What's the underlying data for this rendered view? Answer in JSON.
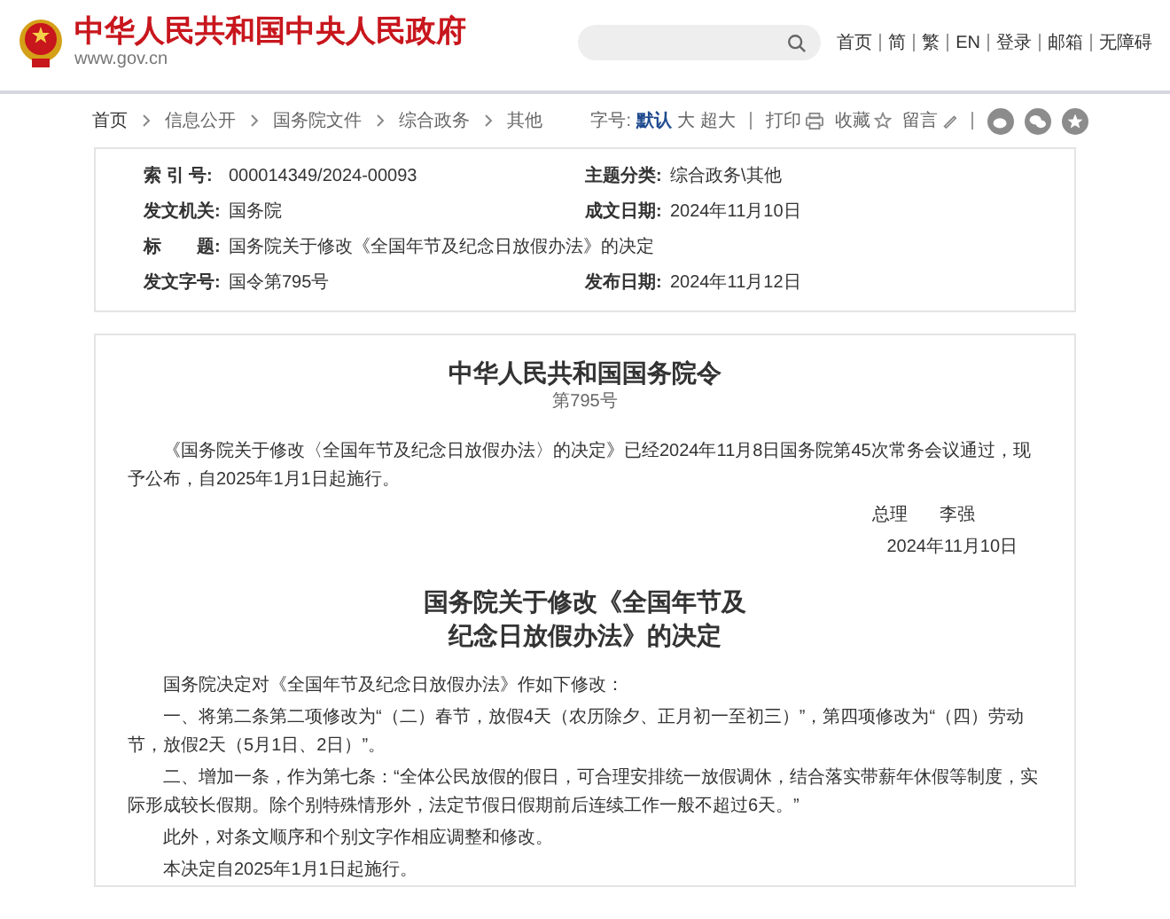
{
  "header": {
    "site_title": "中华人民共和国中央人民政府",
    "domain": "www.gov.cn",
    "nav": [
      {
        "label": "首页"
      },
      {
        "label": "简"
      },
      {
        "label": "繁"
      },
      {
        "label": "EN"
      },
      {
        "label": "登录"
      },
      {
        "label": "邮箱"
      },
      {
        "label": "无障碍"
      }
    ]
  },
  "breadcrumb": [
    {
      "label": "首页"
    },
    {
      "label": "信息公开"
    },
    {
      "label": "国务院文件"
    },
    {
      "label": "综合政务"
    },
    {
      "label": "其他"
    }
  ],
  "tools": {
    "font_label": "字号:",
    "font_sizes": [
      {
        "label": "默认",
        "selected": true
      },
      {
        "label": "大",
        "selected": false
      },
      {
        "label": "超大",
        "selected": false
      }
    ],
    "print": "打印",
    "favorite": "收藏",
    "comment": "留言"
  },
  "meta": [
    [
      {
        "label": "索 引 号:",
        "value": "000014349/2024-00093"
      },
      {
        "label": "主题分类:",
        "value": "综合政务\\其他"
      }
    ],
    [
      {
        "label": "发文机关:",
        "value": "国务院"
      },
      {
        "label": "成文日期:",
        "value": "2024年11月10日"
      }
    ],
    [
      {
        "label": "标　　题:",
        "value": "国务院关于修改《全国年节及纪念日放假办法》的决定"
      }
    ],
    [
      {
        "label": "发文字号:",
        "value": "国令第795号"
      },
      {
        "label": "发布日期:",
        "value": "2024年11月12日"
      }
    ]
  ],
  "document": {
    "title": "中华人民共和国国务院令",
    "number": "第795号",
    "intro": "《国务院关于修改〈全国年节及纪念日放假办法〉的决定》已经2024年11月8日国务院第45次常务会议通过，现予公布，自2025年1月1日起施行。",
    "signer_title": "总理",
    "signer_name": "李强",
    "sign_date": "2024年11月10日",
    "decision_title": [
      "国务院关于修改《全国年节及",
      "纪念日放假办法》的决定"
    ],
    "paragraphs": [
      "国务院决定对《全国年节及纪念日放假办法》作如下修改：",
      "一、将第二条第二项修改为“（二）春节，放假4天（农历除夕、正月初一至初三）”，第四项修改为“（四）劳动节，放假2天（5月1日、2日）”。",
      "二、增加一条，作为第七条：“全体公民放假的假日，可合理安排统一放假调休，结合落实带薪年休假等制度，实际形成较长假期。除个别特殊情形外，法定节假日假期前后连续工作一般不超过6天。”",
      "此外，对条文顺序和个别文字作相应调整和修改。",
      "本决定自2025年1月1日起施行。"
    ]
  }
}
